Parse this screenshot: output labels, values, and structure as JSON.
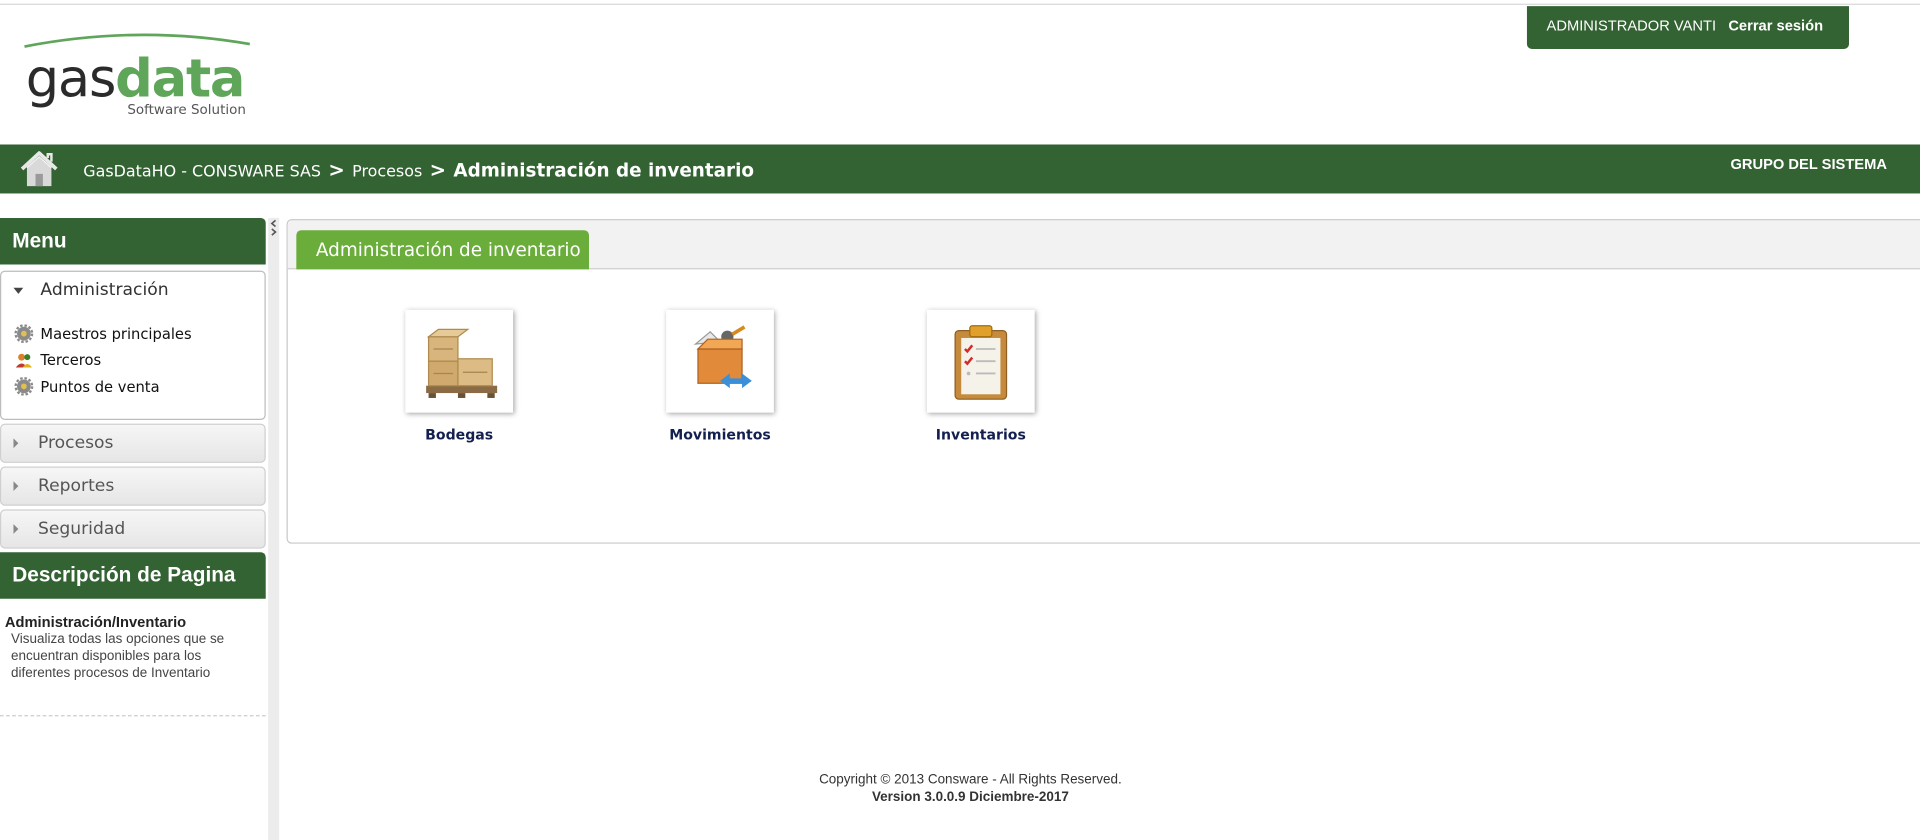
{
  "brand": {
    "word_part1": "gas",
    "word_part2": "data",
    "tagline": "Software Solution",
    "green": "#5fa55a"
  },
  "userbar": {
    "user_name": "ADMINISTRADOR VANTI",
    "logout_label": "Cerrar sesión"
  },
  "nav": {
    "home_icon": "home-icon",
    "breadcrumb": [
      "GasDataHO - CONSWARE SAS",
      "Procesos",
      "Administración de inventario"
    ],
    "separator": ">",
    "group_label": "GRUPO DEL SISTEMA",
    "bar_color": "#336233"
  },
  "sidebar": {
    "menu_title": "Menu",
    "open_section": {
      "label": "Administración",
      "items": [
        {
          "label": "Maestros principales",
          "icon": "gear-icon"
        },
        {
          "label": "Terceros",
          "icon": "people-icon"
        },
        {
          "label": "Puntos de venta",
          "icon": "gear-icon"
        }
      ]
    },
    "closed_sections": [
      "Procesos",
      "Reportes",
      "Seguridad"
    ],
    "desc_title": "Descripción de Pagina",
    "desc_heading": "Administración/Inventario",
    "desc_text": "Visualiza todas las opciones que se encuentran disponibles para los diferentes procesos de Inventario"
  },
  "main": {
    "tab_label": "Administración de inventario",
    "tab_color": "#6aad3a",
    "tiles": [
      {
        "label": "Bodegas",
        "icon": "boxes-pallet-icon"
      },
      {
        "label": "Movimientos",
        "icon": "box-transfer-icon"
      },
      {
        "label": "Inventarios",
        "icon": "clipboard-checklist-icon"
      }
    ]
  },
  "footer": {
    "copyright": "Copyright © 2013 Consware - All Rights Reserved.",
    "version": "Version 3.0.0.9 Diciembre-2017"
  }
}
